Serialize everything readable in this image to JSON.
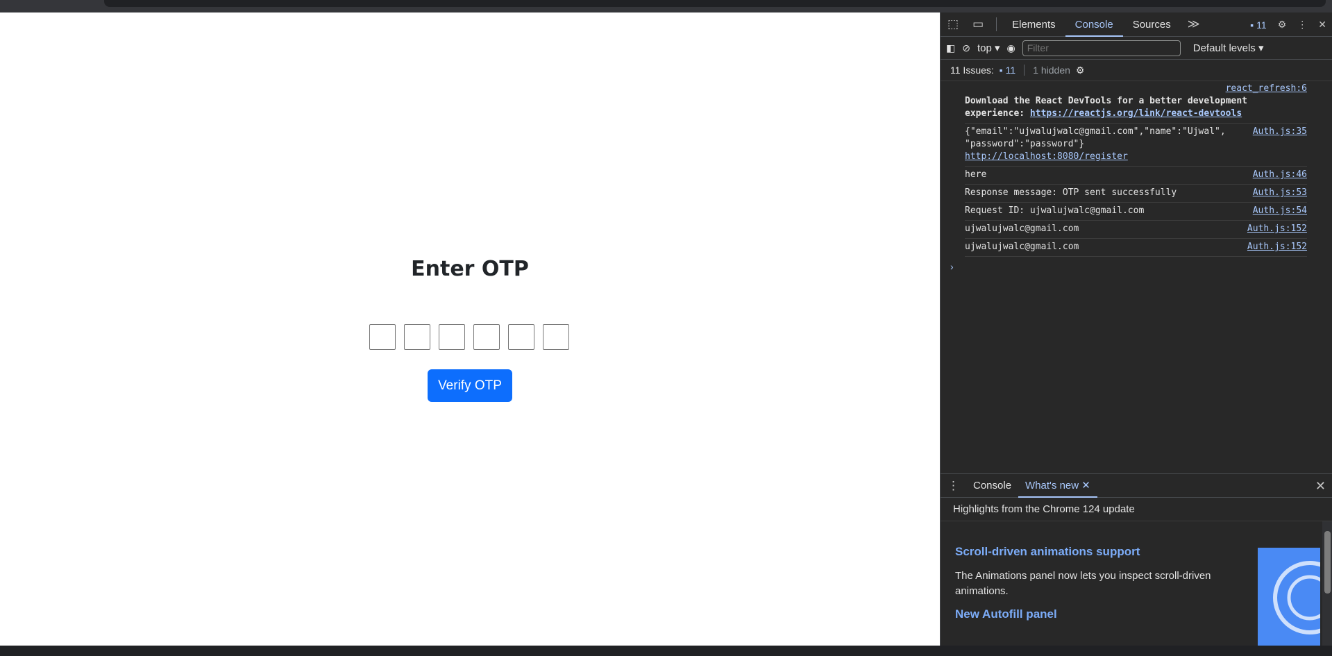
{
  "page": {
    "title": "Enter OTP",
    "otp_box_count": 6,
    "verify_label": "Verify OTP"
  },
  "devtools": {
    "tabs": [
      "Elements",
      "Console",
      "Sources"
    ],
    "active_tab": "Console",
    "more_tabs_glyph": "≫",
    "issues_badge": "11",
    "context": "top",
    "filter_placeholder": "Filter",
    "levels": "Default levels",
    "issues_label": "11 Issues:",
    "issues_count": "11",
    "hidden_label": "1 hidden",
    "messages": [
      {
        "src": "react_refresh:6",
        "text_a": "Download the React DevTools for a better development experience: ",
        "link": "https://reactjs.org/link/react-devtools"
      },
      {
        "src": "Auth.js:35",
        "text_a": "{\"email\":\"ujwalujwalc@gmail.com\",\"name\":\"Ujwal\", \"password\":\"password\"} ",
        "link": "http://localhost:8080/register"
      },
      {
        "src": "Auth.js:46",
        "text": "here"
      },
      {
        "src": "Auth.js:53",
        "text": "Response message: OTP sent successfully"
      },
      {
        "src": "Auth.js:54",
        "text": "Request ID: ujwalujwalc@gmail.com"
      },
      {
        "src": "Auth.js:152",
        "text": "ujwalujwalc@gmail.com"
      },
      {
        "src": "Auth.js:152",
        "text": "ujwalujwalc@gmail.com"
      }
    ],
    "prompt": "›"
  },
  "drawer": {
    "tabs": [
      "Console",
      "What's new"
    ],
    "active_tab": "What's new",
    "highlights": "Highlights from the Chrome 124 update",
    "items": [
      {
        "title": "Scroll-driven animations support",
        "body": "The Animations panel now lets you inspect scroll-driven animations."
      },
      {
        "title": "New Autofill panel"
      }
    ]
  },
  "colors": {
    "accent": "#a8c7fa",
    "button": "#0d6efd",
    "devtools_bg": "#282828"
  }
}
